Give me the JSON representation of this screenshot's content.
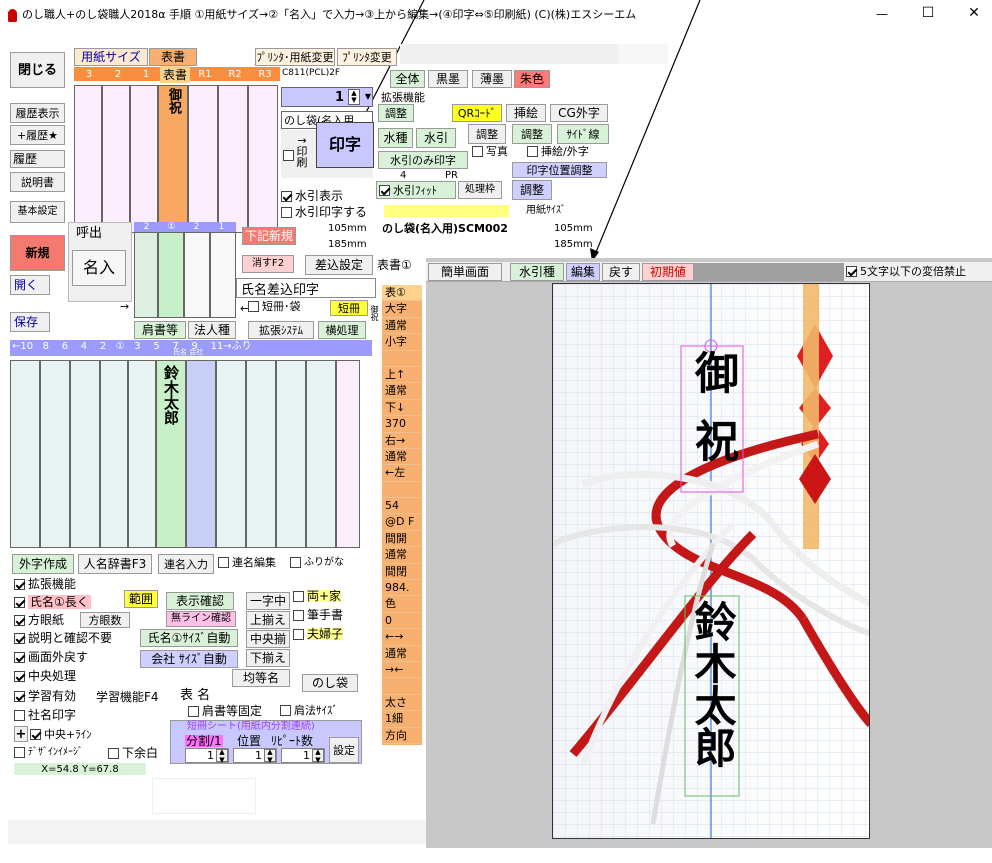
{
  "titlebar": {
    "title": "のし職人+のし袋職人2018α  手順  ①用紙サイズ→②「名入」で入力→③上から編集→(④印字⇔⑤印刷紙)    (C)(株)エスシーエム",
    "min": "—",
    "max": "☐",
    "close": "✕"
  },
  "left": {
    "close": "閉じる",
    "history_show": "履歴表示",
    "history_add": "+履歴★",
    "history": "履歴",
    "manual": "説明書",
    "settings": "基本設定",
    "new": "新規"
  },
  "top": {
    "paper_size": "用紙サイズ",
    "omote": "表書",
    "printer_change": "ﾌﾟﾘﾝﾀ･用紙変更",
    "printer_change2": "ﾌﾟﾘﾝﾀ変更",
    "col_nums": [
      "3",
      "2",
      "1",
      "表書",
      "R1",
      "R2",
      "R3"
    ],
    "code": "C811(PCL)2F",
    "all": "全体",
    "black": "黒墨",
    "light": "薄墨",
    "red": "朱色",
    "spinner": "1",
    "kakucho": "拡張機能",
    "chosei": "調整",
    "qr": "QRｺｰﾄﾞ",
    "sashie": "挿絵",
    "cg": "CG外字",
    "dropdown": "のし袋(名入用",
    "print": "印字",
    "print_check": "↑印刷",
    "mizuhiki_kind": "水種",
    "mizuhiki": "水引",
    "chosei2": "調整",
    "chosei3": "調整",
    "side_line": "ｻｲﾄﾞ線",
    "mizuhiki_only": "水引のみ印字",
    "photo": "写真",
    "illust": "挿絵/外字",
    "num4": "4",
    "pr": "PR",
    "pos_adjust": "印字位置調整",
    "mizuhiki_show": "水引表示",
    "mizuhiki_fit": "水引ﾌｨｯﾄ",
    "frame": "処理枠",
    "chosei4": "調整",
    "mizuhiki_print": "水引印字する",
    "paper_size2": "用紙ｻｲｽﾞ",
    "w1": "105mm",
    "h1": "185mm",
    "paper_name": "のし袋(名入用)SCM002",
    "w2": "105mm",
    "h2": "185mm",
    "omote_char": [
      "御",
      "祝"
    ]
  },
  "mid": {
    "yobidashi": "呼出",
    "nairi": "名入",
    "new_below": "下記新規",
    "kesu": "消すF2",
    "sashikomi": "差込設定",
    "name_insert": "氏名差込印字",
    "tanzaku_fukuro": "短冊･袋",
    "tanzaku": "短冊",
    "omote1": "表書①",
    "goshuku": "御祝",
    "arrow": "→",
    "arrow_l": "←",
    "katagaki": "肩書等",
    "hojin": "法人種",
    "kakucho_sys": "拡張ｼｽﾃﾑ",
    "yoko": "横処理",
    "top_nums": [
      "2",
      "①",
      "2",
      "1"
    ],
    "bottom_nums": "←10   8    6    4    2   ①   3    5    7    9    11→ふり",
    "name_label": "氏名  会社",
    "name": [
      "鈴",
      "木",
      "太",
      "郎"
    ]
  },
  "side": [
    "表①",
    "大字",
    "通常",
    "小字",
    "",
    "上↑",
    "通常",
    "下↓",
    "370",
    "右→",
    "通常",
    "←左",
    "",
    "54",
    "@D F",
    "間開",
    "通常",
    "間閉",
    "984.",
    "色",
    "0",
    "←→",
    "通常",
    "→←",
    "",
    "太さ",
    "1細",
    "方向"
  ],
  "bottom": {
    "gaiji": "外字作成",
    "jisho": "人名辞書F3",
    "renmei": "連名入力",
    "renmei_edit": "連名編集",
    "furigana": "ふりがな",
    "kakucho": "拡張機能",
    "shimei_long": "氏名①長く",
    "hogan": "方眼紙",
    "hogansu": "方眼数",
    "setsumei": "説明と確認不要",
    "gamen": "画面外戻す",
    "chuo": "中央処理",
    "gakushu": "学習有効",
    "gakushu_f4": "学習機能F4",
    "shamei": "社名印字",
    "plus": "+",
    "chuo_line": "中央+ﾗｲﾝ",
    "design": "ﾃﾞｻﾞｲﾝｲﾒｰｼﾞ",
    "shitayohaku": "下余白",
    "coords": "X=54.8 Y=67.8",
    "hani": "範囲",
    "hyoji": "表示確認",
    "noline": "無ライン確認",
    "shimei_auto": "氏名①ｻｲｽﾞ自動",
    "kaisha_auto": "会社 ｻｲｽﾞ自動",
    "ichijichu": "一字中",
    "uwasoroe": "上揃え",
    "chuosoroe": "中央揃",
    "shitasoroe": "下揃え",
    "kintomei": "均等名",
    "ryoke": "両+家",
    "fude": "筆手書",
    "fufu": "夫婦子",
    "noshi": "のし袋",
    "omote_na": "表 名",
    "katagaki_kotei": "肩書等固定",
    "kataho": "肩法ｻｲｽﾞ",
    "tanzaku_sheet": "短冊シート(用紙内分割連続)",
    "bunkatsu": "分割/1",
    "ichi": "位置",
    "repeat": "ﾘﾋﾟｰﾄ数",
    "s1": "1",
    "s2": "1",
    "s3": "1",
    "settei": "設定"
  },
  "preview": {
    "tabs": [
      "簡単画面",
      "水引種",
      "編集",
      "戻す",
      "初期値"
    ],
    "limit": "5文字以下の変倍禁止",
    "omote": [
      "御",
      "祝"
    ],
    "name": [
      "鈴",
      "木",
      "太",
      "郎"
    ]
  }
}
